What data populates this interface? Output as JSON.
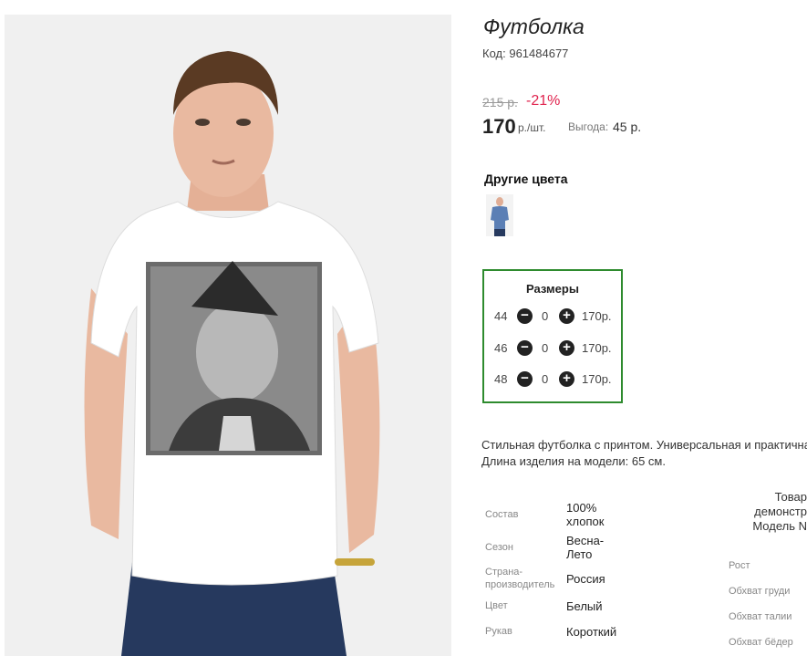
{
  "product": {
    "title": "Футболка",
    "code_label": "Код:",
    "code_value": "961484677"
  },
  "pricing": {
    "old_price": "215 р.",
    "discount": "-21%",
    "price": "170",
    "price_unit": "р./шт.",
    "benefit_label": "Выгода:",
    "benefit_value": "45 р."
  },
  "colors": {
    "heading": "Другие цвета",
    "accent": "#2e8b2e",
    "discount_color": "#e0234e"
  },
  "sizes": {
    "heading": "Размеры",
    "rows": [
      {
        "size": "44",
        "qty": "0",
        "price": "170р."
      },
      {
        "size": "46",
        "qty": "0",
        "price": "170р."
      },
      {
        "size": "48",
        "qty": "0",
        "price": "170р."
      }
    ],
    "minus_symbol": "−",
    "plus_symbol": "+"
  },
  "description": {
    "line1": "Стильная футболка с принтом. Универсальная и практичная",
    "line2": "Длина изделия на модели: 65 см."
  },
  "specs": [
    {
      "label": "Состав",
      "value": "100% хлопок"
    },
    {
      "label": "Сезон",
      "value": "Весна-Лето"
    },
    {
      "label": "Страна-производитель",
      "value": "Россия"
    },
    {
      "label": "Цвет",
      "value": "Белый"
    },
    {
      "label": "Рукав",
      "value": "Короткий"
    }
  ],
  "model": {
    "line1": "Товар",
    "line2": "демонстр",
    "line3": "Модель N",
    "measures": [
      "Рост",
      "Обхват груди",
      "Обхват талии",
      "Обхват бёдер"
    ]
  }
}
